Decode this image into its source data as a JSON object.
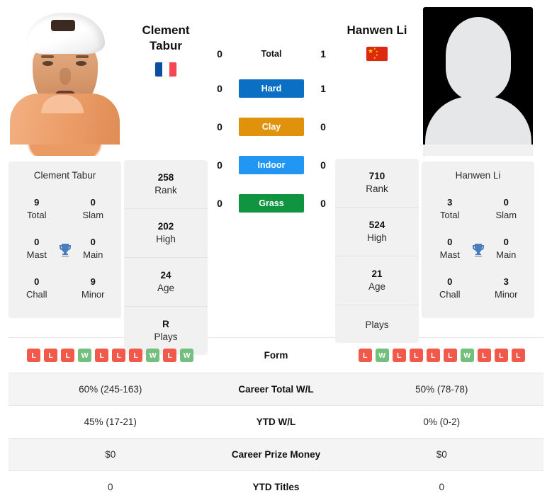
{
  "players": {
    "left": {
      "name_line1": "Clement",
      "name_line2": "Tabur",
      "full_name": "Clement Tabur",
      "flag": "france-flag",
      "photo": "player-photo",
      "rank": "258",
      "rank_label": "Rank",
      "high": "202",
      "high_label": "High",
      "age": "24",
      "age_label": "Age",
      "plays": "R",
      "plays_label": "Plays",
      "titles": {
        "total": "9",
        "total_label": "Total",
        "slam": "0",
        "slam_label": "Slam",
        "mast": "0",
        "mast_label": "Mast",
        "main": "0",
        "main_label": "Main",
        "chall": "0",
        "chall_label": "Chall",
        "minor": "9",
        "minor_label": "Minor"
      },
      "form": [
        "L",
        "L",
        "L",
        "W",
        "L",
        "L",
        "L",
        "W",
        "L",
        "W"
      ],
      "career_wl": "60% (245-163)",
      "ytd_wl": "45% (17-21)",
      "prize_money": "$0",
      "ytd_titles": "0"
    },
    "right": {
      "name_line1": "Hanwen Li",
      "name_line2": "",
      "full_name": "Hanwen Li",
      "flag": "china-flag",
      "photo": "silhouette-placeholder",
      "rank": "710",
      "rank_label": "Rank",
      "high": "524",
      "high_label": "High",
      "age": "21",
      "age_label": "Age",
      "plays": "",
      "plays_label": "Plays",
      "titles": {
        "total": "3",
        "total_label": "Total",
        "slam": "0",
        "slam_label": "Slam",
        "mast": "0",
        "mast_label": "Mast",
        "main": "0",
        "main_label": "Main",
        "chall": "0",
        "chall_label": "Chall",
        "minor": "3",
        "minor_label": "Minor"
      },
      "form": [
        "L",
        "W",
        "L",
        "L",
        "L",
        "L",
        "W",
        "L",
        "L",
        "L"
      ],
      "career_wl": "50% (78-78)",
      "ytd_wl": "0% (0-2)",
      "prize_money": "$0",
      "ytd_titles": "0"
    }
  },
  "head_to_head": [
    {
      "label": "Total",
      "left": "0",
      "right": "1",
      "style": "plain",
      "color": ""
    },
    {
      "label": "Hard",
      "left": "0",
      "right": "1",
      "style": "badge",
      "color": "#0b6fc4"
    },
    {
      "label": "Clay",
      "left": "0",
      "right": "0",
      "style": "badge",
      "color": "#e0920d"
    },
    {
      "label": "Indoor",
      "left": "0",
      "right": "0",
      "style": "badge",
      "color": "#2196f3"
    },
    {
      "label": "Grass",
      "left": "0",
      "right": "0",
      "style": "badge",
      "color": "#109440"
    }
  ],
  "table": {
    "rows": [
      {
        "label": "Form",
        "key": "form",
        "type": "form"
      },
      {
        "label": "Career Total W/L",
        "key": "career_wl",
        "type": "text"
      },
      {
        "label": "YTD W/L",
        "key": "ytd_wl",
        "type": "text"
      },
      {
        "label": "Career Prize Money",
        "key": "prize_money",
        "type": "text"
      },
      {
        "label": "YTD Titles",
        "key": "ytd_titles",
        "type": "text"
      }
    ]
  },
  "colors": {
    "win": "#73bf7d",
    "loss": "#f1594a",
    "card_bg": "#f1f1f1",
    "row_alt": "#f4f4f4"
  }
}
